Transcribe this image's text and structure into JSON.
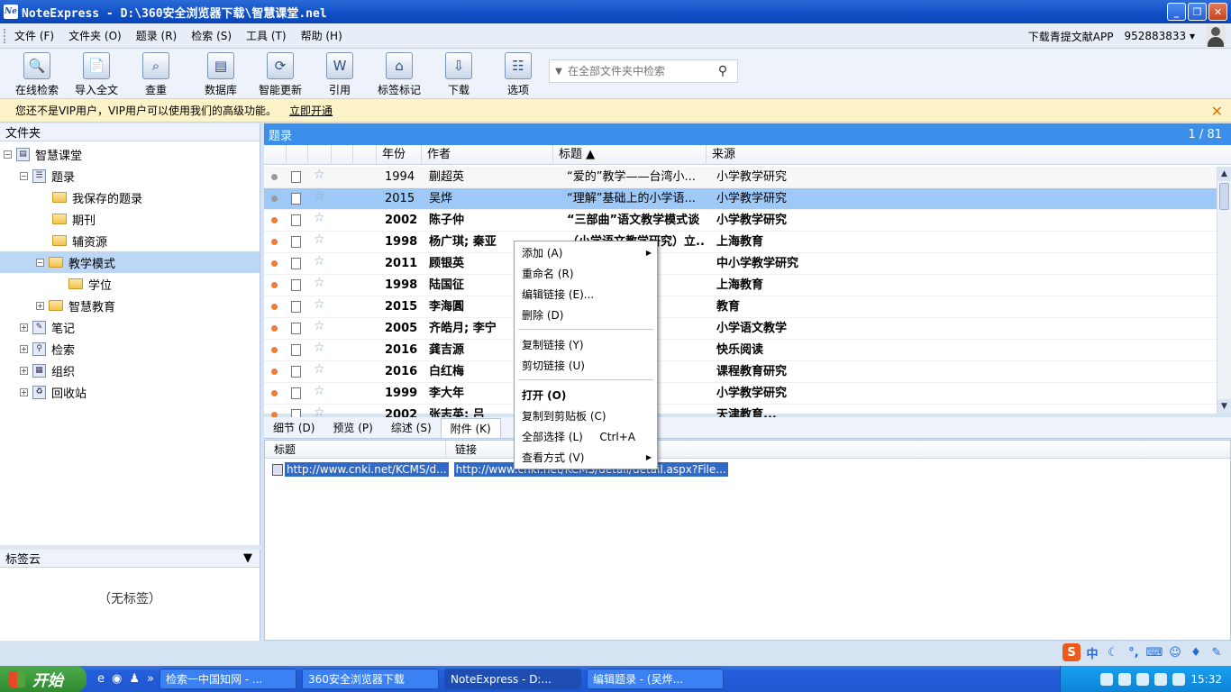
{
  "window": {
    "title": "NoteExpress - D:\\360安全浏览器下载\\智慧课堂.nel",
    "app_icon": "Ne"
  },
  "menubar": {
    "items": [
      "文件 (F)",
      "文件夹 (O)",
      "题录 (R)",
      "检索 (S)",
      "工具 (T)",
      "帮助 (H)"
    ],
    "download_app": "下载青提文献APP",
    "user_id": "952883833 ▾"
  },
  "toolbar": {
    "tools": [
      "在线检索",
      "导入全文",
      "查重",
      "数据库",
      "智能更新",
      "引用",
      "标签标记",
      "下载",
      "选项"
    ],
    "search_placeholder": "在全部文件夹中检索"
  },
  "vip": {
    "message": "您还不是VIP用户，VIP用户可以使用我们的高级功能。",
    "link": "立即开通"
  },
  "left": {
    "header": "文件夹",
    "tree": [
      "智慧课堂",
      "题录",
      "我保存的题录",
      "期刊",
      "辅资源",
      "教学模式",
      "学位",
      "智慧教育",
      "笔记",
      "检索",
      "组织",
      "回收站"
    ],
    "tag_header": "标签云",
    "tag_empty": "（无标签）"
  },
  "list": {
    "header": "题录",
    "counter": "1 / 81",
    "columns": [
      "年份",
      "作者",
      "标题",
      "来源"
    ],
    "rows": [
      {
        "year": "1994",
        "author": "蒯超英",
        "title": "“爱的”教学——台湾小...",
        "source": "小学教学研究"
      },
      {
        "year": "2015",
        "author": "吴烨",
        "title": "“理解”基础上的小学语...",
        "source": "小学教学研究"
      },
      {
        "year": "2002",
        "author": "陈子仲",
        "title": "“三部曲”语文教学模式谈",
        "source": "小学教学研究"
      },
      {
        "year": "1998",
        "author": "杨广琪; 秦亚",
        "title": "（小学语文教学研究）立...",
        "source": "上海教育"
      },
      {
        "year": "2011",
        "author": "顾银英",
        "title": "导学”...",
        "source": "中小学教学研究"
      },
      {
        "year": "1998",
        "author": "陆国征",
        "title": "到“激...",
        "source": "上海教育"
      },
      {
        "year": "2015",
        "author": "李海圓",
        "title": "学教学...",
        "source": "教育"
      },
      {
        "year": "2005",
        "author": "齐皓月; 李宁",
        "title": "变轨迹...",
        "source": "小学语文教学"
      },
      {
        "year": "2016",
        "author": "龚吉源",
        "title": "小学数...",
        "source": "快乐阅读"
      },
      {
        "year": "2016",
        "author": "白红梅",
        "title": "学模式...",
        "source": "课程教育研究"
      },
      {
        "year": "1999",
        "author": "李大年",
        "title": "学模式",
        "source": "小学教学研究"
      },
      {
        "year": "2002",
        "author": "张志英; 吕",
        "title": "学...",
        "source": "天津教育..."
      }
    ]
  },
  "tabs": [
    "细节 (D)",
    "预览 (P)",
    "综述 (S)",
    "附件 (K)"
  ],
  "attachments": {
    "columns": [
      "标题",
      "链接"
    ],
    "row": {
      "title": "http://www.cnki.net/KCMS/d...",
      "link": "http://www.cnki.net/KCMS/detail/detail.aspx?File..."
    }
  },
  "context_menu": {
    "items": [
      "添加 (A)",
      "重命名 (R)",
      "编辑链接 (E)...",
      "删除 (D)",
      "复制链接 (Y)",
      "剪切链接 (U)",
      "打开 (O)",
      "复制到剪贴板 (C)",
      "全部选择 (L)",
      "查看方式 (V)"
    ],
    "shortcut": "Ctrl+A"
  },
  "taskbar": {
    "start": "开始",
    "items": [
      "检索一中国知网 - ...",
      "360安全浏览器下载",
      "NoteExpress - D:...",
      "编辑题录 - (吴烨..."
    ],
    "time": "15:32"
  },
  "colors": {
    "accent": "#3b8ee9",
    "selection": "#9ec8f5",
    "dot": "#ef7e3b"
  }
}
